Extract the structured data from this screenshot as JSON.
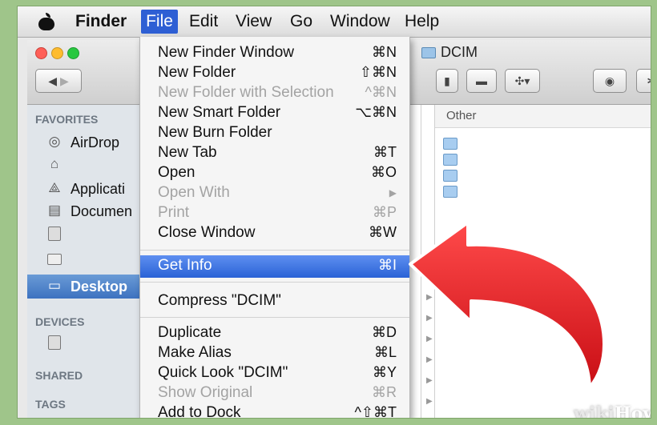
{
  "menubar": {
    "items": [
      "Finder",
      "File",
      "Edit",
      "View",
      "Go",
      "Window",
      "Help"
    ]
  },
  "window": {
    "title": "DCIM",
    "back_icon": "back-arrow-icon",
    "forward_icon": "forward-arrow-icon"
  },
  "sidebar": {
    "favorites_label": "FAVORITES",
    "items": [
      {
        "label": "AirDrop",
        "icon": "airdrop-icon"
      },
      {
        "label": "",
        "icon": "home-icon"
      },
      {
        "label": "Applicati",
        "icon": "applications-icon"
      },
      {
        "label": "Documen",
        "icon": "documents-icon"
      },
      {
        "label": "",
        "icon": "drive-icon"
      },
      {
        "label": "",
        "icon": "folder-icon"
      },
      {
        "label": "Desktop",
        "icon": "desktop-icon"
      }
    ],
    "devices_label": "DEVICES",
    "shared_label": "SHARED",
    "tags_label": "TAGS"
  },
  "columns": {
    "other_header": "Other"
  },
  "file_menu": {
    "items": [
      {
        "label": "New Finder Window",
        "shortcut": "⌘N",
        "disabled": false
      },
      {
        "label": "New Folder",
        "shortcut": "⇧⌘N",
        "disabled": false
      },
      {
        "label": "New Folder with Selection",
        "shortcut": "^⌘N",
        "disabled": true
      },
      {
        "label": "New Smart Folder",
        "shortcut": "⌥⌘N",
        "disabled": false
      },
      {
        "label": "New Burn Folder",
        "shortcut": "",
        "disabled": false
      },
      {
        "label": "New Tab",
        "shortcut": "⌘T",
        "disabled": false
      },
      {
        "label": "Open",
        "shortcut": "⌘O",
        "disabled": false
      },
      {
        "label": "Open With",
        "shortcut": "▶",
        "disabled": true
      },
      {
        "label": "Print",
        "shortcut": "⌘P",
        "disabled": true
      },
      {
        "label": "Close Window",
        "shortcut": "⌘W",
        "disabled": false
      },
      {
        "label": "Get Info",
        "shortcut": "⌘I",
        "disabled": false,
        "highlighted": true
      },
      {
        "label": "Compress \"DCIM\"",
        "shortcut": "",
        "disabled": false
      },
      {
        "label": "Duplicate",
        "shortcut": "⌘D",
        "disabled": false
      },
      {
        "label": "Make Alias",
        "shortcut": "⌘L",
        "disabled": false
      },
      {
        "label": "Quick Look \"DCIM\"",
        "shortcut": "⌘Y",
        "disabled": false
      },
      {
        "label": "Show Original",
        "shortcut": "⌘R",
        "disabled": true
      },
      {
        "label": "Add to Dock",
        "shortcut": "^⇧⌘T",
        "disabled": false
      }
    ]
  },
  "watermark": {
    "part1": "wiki",
    "part2": "How"
  },
  "colors": {
    "menu_highlight": "#2a62d6",
    "sidebar_selected": "#3d72c0",
    "arrow_red": "#e0141c"
  }
}
